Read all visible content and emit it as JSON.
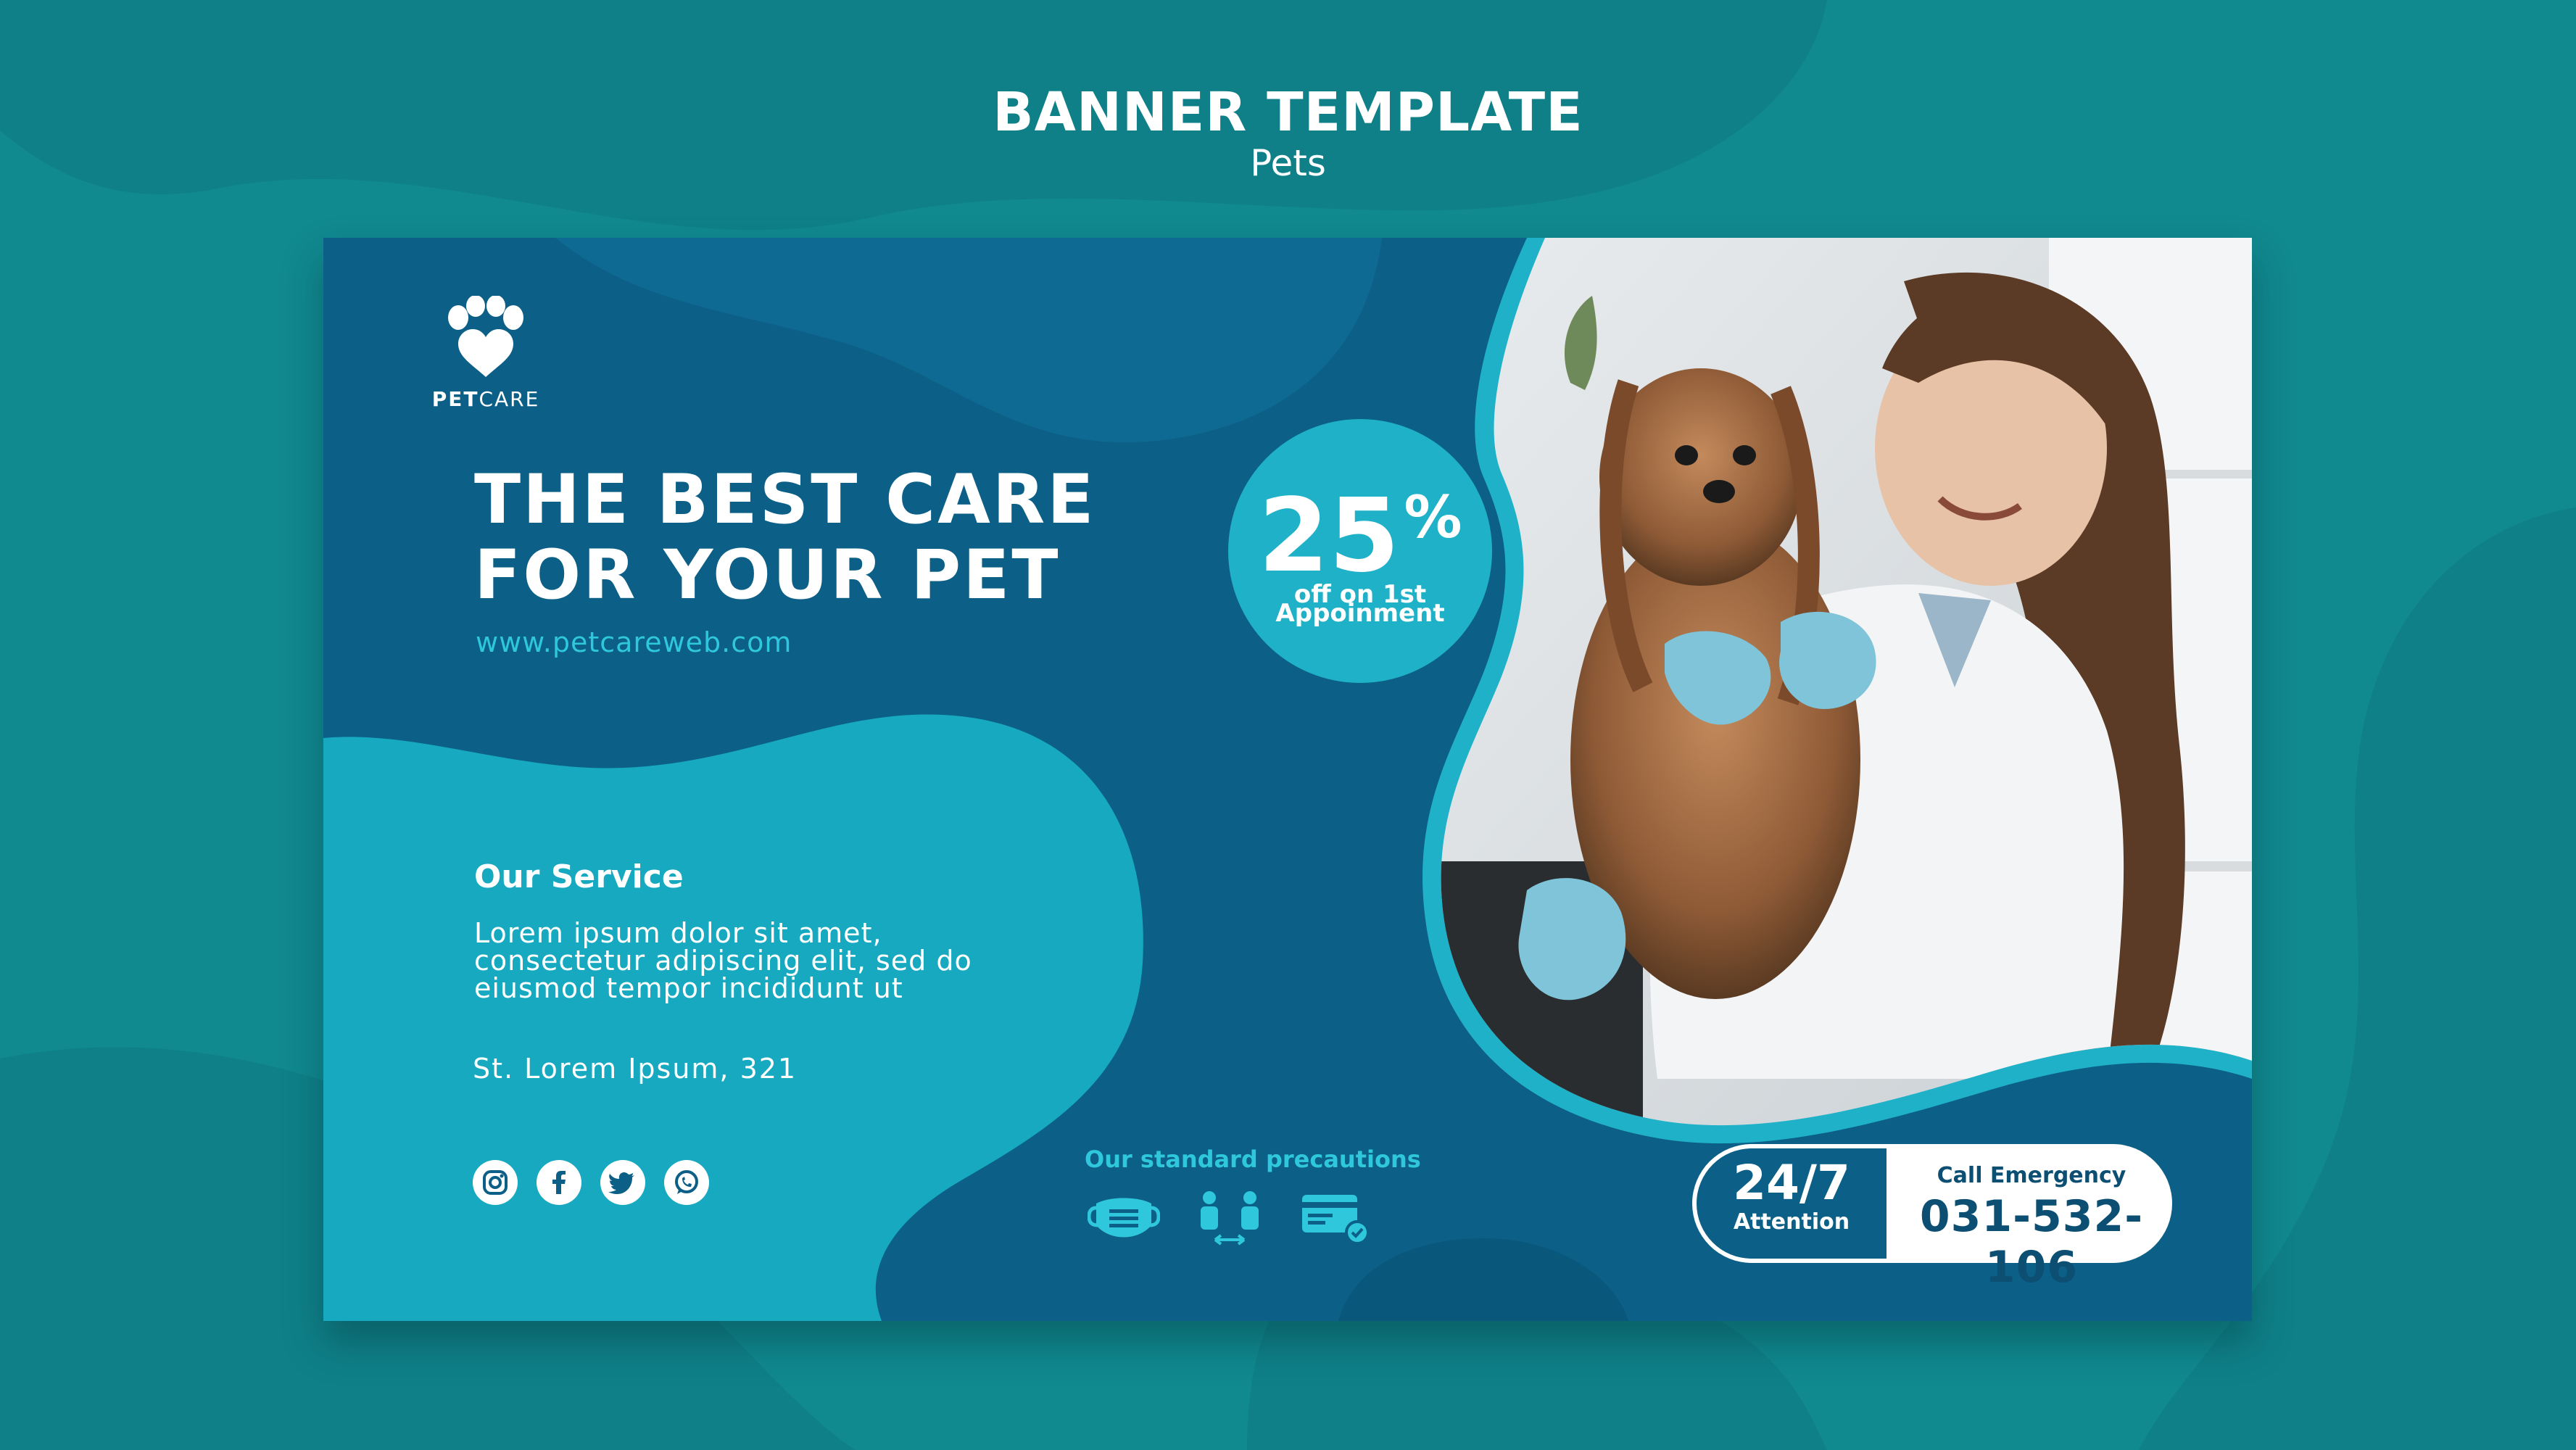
{
  "header": {
    "title": "BANNER TEMPLATE",
    "subtitle": "Pets"
  },
  "banner": {
    "logo": {
      "icon": "paw-heart-icon",
      "text_bold": "PET",
      "text_light": "CARE"
    },
    "headline": {
      "line1": "THE BEST CARE",
      "line2": "FOR YOUR PET"
    },
    "website": "www.petcareweb.com",
    "discount": {
      "percent": "25",
      "symbol": "%",
      "line1": "off on 1st",
      "line2": "Appoinment"
    },
    "service": {
      "title": "Our Service",
      "lines": [
        "Lorem ipsum dolor sit amet,",
        "consectetur adipiscing elit, sed do",
        "eiusmod tempor incididunt ut"
      ]
    },
    "address": "St. Lorem Ipsum, 321",
    "socials": [
      "instagram-icon",
      "facebook-icon",
      "twitter-icon",
      "whatsapp-icon"
    ],
    "precautions": {
      "title": "Our standard precautions",
      "icons": [
        "face-mask-icon",
        "social-distance-icon",
        "card-payment-icon"
      ]
    },
    "emergency": {
      "hours": "24/7",
      "hours_label": "Attention",
      "call_label": "Call Emergency",
      "phone": "031-532-106"
    },
    "photo": {
      "description_icon": "vet-with-dog-photo"
    }
  },
  "colors": {
    "page_bg": "#10898f",
    "banner_dark": "#0c5f86",
    "banner_light": "#1fb1c7",
    "accent_text": "#2ec7dc",
    "white": "#ffffff"
  }
}
